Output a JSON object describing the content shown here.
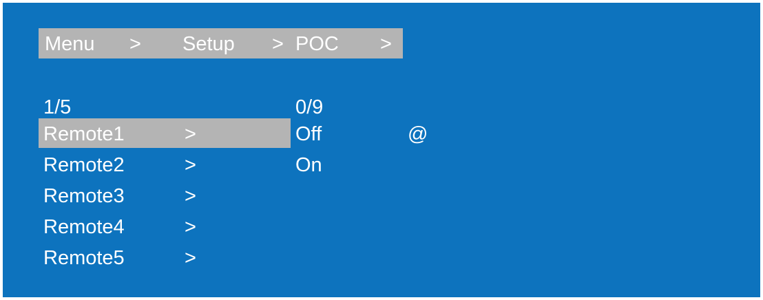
{
  "breadcrumb": {
    "items": [
      "Menu",
      "Setup",
      "POC"
    ],
    "separator": ">"
  },
  "menu": {
    "page_indicator": "1/5",
    "items": [
      {
        "label": "Remote1",
        "arrow": ">",
        "selected": true
      },
      {
        "label": "Remote2",
        "arrow": ">",
        "selected": false
      },
      {
        "label": "Remote3",
        "arrow": ">",
        "selected": false
      },
      {
        "label": "Remote4",
        "arrow": ">",
        "selected": false
      },
      {
        "label": "Remote5",
        "arrow": ">",
        "selected": false
      }
    ]
  },
  "options": {
    "page_indicator": "0/9",
    "items": [
      "Off",
      "On"
    ],
    "current_marker": "@"
  },
  "colors": {
    "background": "#0d73be",
    "highlight": "#b4b4b4",
    "text": "#ffffff"
  }
}
